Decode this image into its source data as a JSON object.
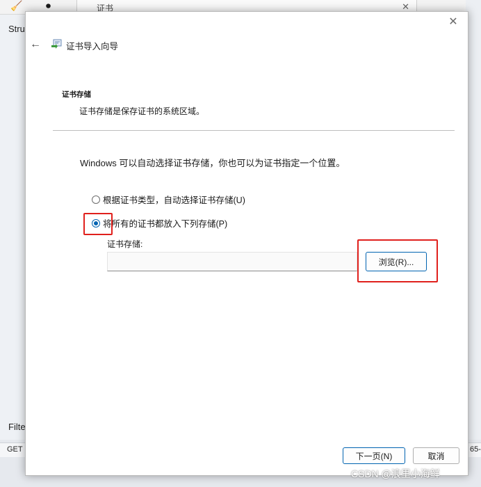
{
  "background": {
    "tab_title": "证书",
    "left_text_1": "Stru",
    "left_text_2": "Filte",
    "left_text_3": "GET I",
    "right_text": "65-"
  },
  "dialog": {
    "title": "证书导入向导",
    "section_title": "证书存储",
    "section_subtitle": "证书存储是保存证书的系统区域。",
    "intro": "Windows 可以自动选择证书存储，你也可以为证书指定一个位置。",
    "options": [
      {
        "label": "根据证书类型，自动选择证书存储(U)",
        "checked": false
      },
      {
        "label": "将所有的证书都放入下列存储(P)",
        "checked": true
      }
    ],
    "store_label": "证书存储:",
    "store_value": "",
    "browse_label": "浏览(R)...",
    "next_label": "下一页(N)",
    "cancel_label": "取消"
  },
  "watermark": "CSDN @浪里小海鲜",
  "colors": {
    "accent": "#0063b1",
    "highlight_box": "#e0201c"
  }
}
